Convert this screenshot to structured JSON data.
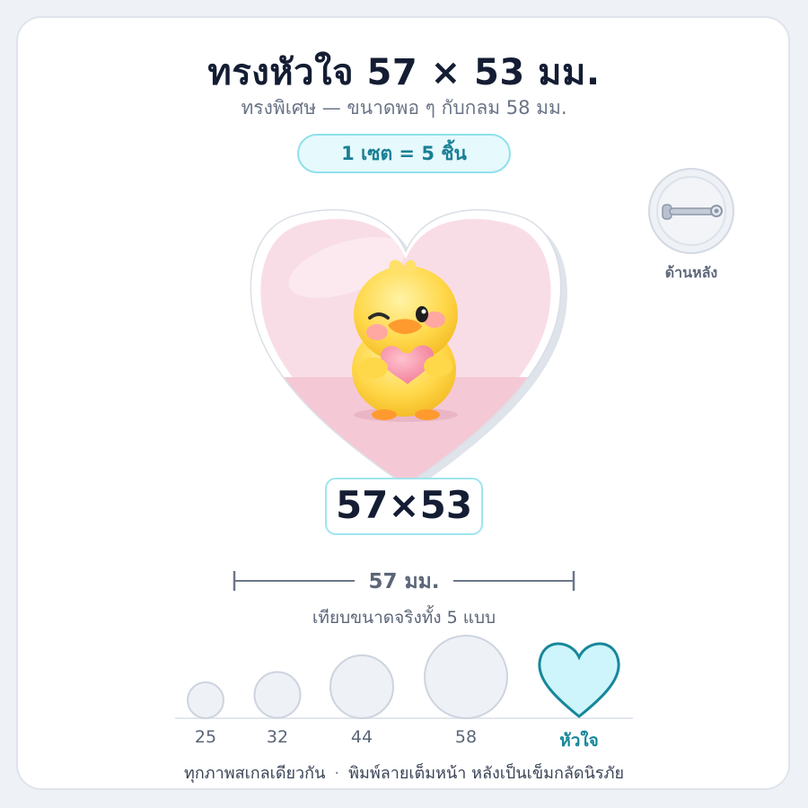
{
  "header": {
    "title": "ทรงหัวใจ 57 × 53 มม.",
    "subtitle": "ทรงพิเศษ — ขนาดพอ ๆ กับกลม 58 มม.",
    "set_badge": "1 เซต = 5 ชิ้น"
  },
  "back_view": {
    "label": "ด้านหลัง",
    "icon": "safety-pin-icon"
  },
  "product": {
    "image": "yellow-duck-holding-heart",
    "size_label": "57×53",
    "width_label": "57 มม."
  },
  "comparison": {
    "title": "เทียบขนาดจริงทั้ง 5 แบบ",
    "sizes": [
      {
        "label": "25",
        "shape": "circle"
      },
      {
        "label": "32",
        "shape": "circle"
      },
      {
        "label": "44",
        "shape": "circle"
      },
      {
        "label": "58",
        "shape": "circle"
      },
      {
        "label": "หัวใจ",
        "shape": "heart",
        "active": true
      }
    ]
  },
  "footer": {
    "note_left": "ทุกภาพสเกลเดียวกัน",
    "separator": "·",
    "note_right": "พิมพ์ลายเต็มหน้า หลังเป็นเข็มกลัดนิรภัย"
  },
  "colors": {
    "accent": "#17879b",
    "accent_light": "#cdf5fb",
    "heart_pink": "#f9dde6"
  }
}
